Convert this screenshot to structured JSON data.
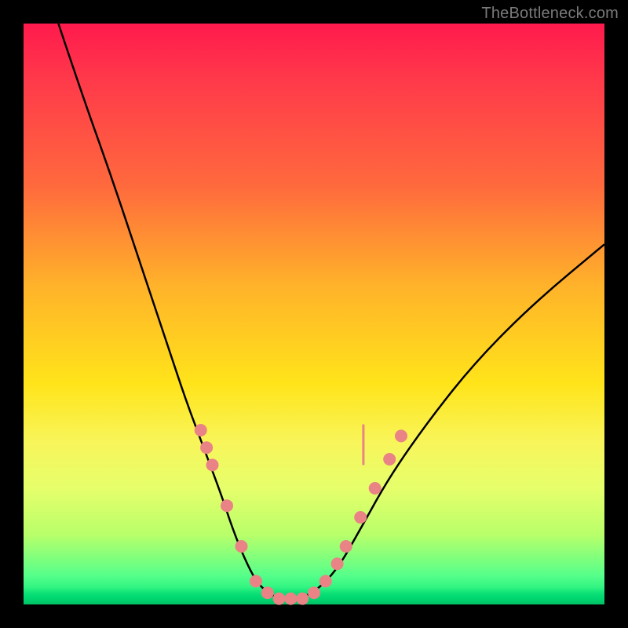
{
  "watermark": "TheBottleneck.com",
  "colors": {
    "background": "#000000",
    "gradient_top": "#ff1a4d",
    "gradient_bottom": "#00c265",
    "curve": "#000000",
    "markers": "#e98385"
  },
  "chart_data": {
    "type": "line",
    "title": "",
    "xlabel": "",
    "ylabel": "",
    "xlim": [
      0,
      100
    ],
    "ylim": [
      0,
      100
    ],
    "grid": false,
    "legend": false,
    "series": [
      {
        "name": "bottleneck-curve",
        "x": [
          6,
          10,
          15,
          20,
          25,
          28,
          31,
          34,
          36,
          38,
          40,
          42,
          44,
          47,
          50,
          54,
          58,
          63,
          70,
          78,
          88,
          100
        ],
        "y": [
          100,
          88,
          74,
          59,
          44,
          35,
          27,
          19,
          13,
          8,
          4,
          2,
          1,
          1,
          2,
          6,
          13,
          22,
          32,
          42,
          52,
          62
        ]
      }
    ],
    "annotations": {
      "marker_dots": [
        {
          "x": 30.5,
          "y": 30
        },
        {
          "x": 31.5,
          "y": 27
        },
        {
          "x": 32.5,
          "y": 24
        },
        {
          "x": 35.0,
          "y": 17
        },
        {
          "x": 37.5,
          "y": 10
        },
        {
          "x": 40.0,
          "y": 4
        },
        {
          "x": 42.0,
          "y": 2
        },
        {
          "x": 44.0,
          "y": 1
        },
        {
          "x": 46.0,
          "y": 1
        },
        {
          "x": 48.0,
          "y": 1
        },
        {
          "x": 50.0,
          "y": 2
        },
        {
          "x": 52.0,
          "y": 4
        },
        {
          "x": 54.0,
          "y": 7
        },
        {
          "x": 55.5,
          "y": 10
        },
        {
          "x": 58.0,
          "y": 15
        },
        {
          "x": 60.5,
          "y": 20
        },
        {
          "x": 63.0,
          "y": 25
        },
        {
          "x": 65.0,
          "y": 29
        }
      ],
      "marker_ticks": [
        {
          "x": 58.5,
          "y_from": 24,
          "y_to": 31
        }
      ]
    }
  }
}
